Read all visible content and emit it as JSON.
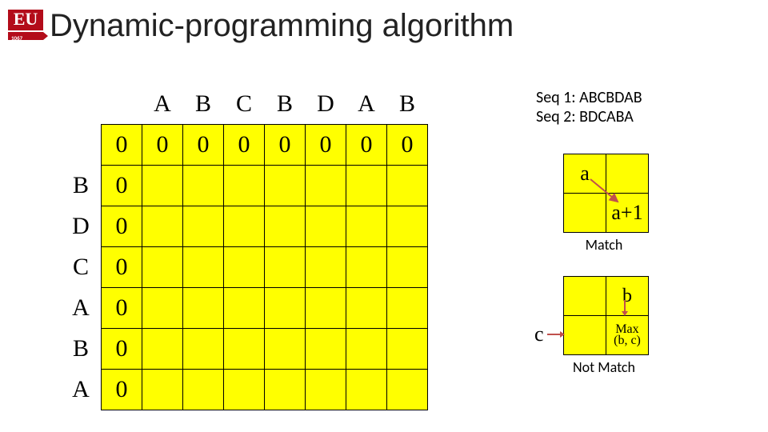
{
  "logo": {
    "text": "EU",
    "year": "1067"
  },
  "title": "Dynamic-programming algorithm",
  "dp": {
    "col_headers": [
      "",
      "A",
      "B",
      "C",
      "B",
      "D",
      "A",
      "B"
    ],
    "row_headers": [
      "",
      "B",
      "D",
      "C",
      "A",
      "B",
      "A"
    ],
    "cells": [
      [
        "0",
        "0",
        "0",
        "0",
        "0",
        "0",
        "0",
        "0"
      ],
      [
        "0",
        "",
        "",
        "",
        "",
        "",
        "",
        ""
      ],
      [
        "0",
        "",
        "",
        "",
        "",
        "",
        "",
        ""
      ],
      [
        "0",
        "",
        "",
        "",
        "",
        "",
        "",
        ""
      ],
      [
        "0",
        "",
        "",
        "",
        "",
        "",
        "",
        ""
      ],
      [
        "0",
        "",
        "",
        "",
        "",
        "",
        "",
        ""
      ],
      [
        "0",
        "",
        "",
        "",
        "",
        "",
        "",
        ""
      ]
    ]
  },
  "seq1_label": "Seq 1: ABCBDAB",
  "seq2_label": "Seq 2: BDCABA",
  "match_box": {
    "tl": "a",
    "br": "a+1",
    "caption": "Match"
  },
  "notmatch_box": {
    "tr": "b",
    "left_label": "c",
    "br_line1": "Max",
    "br_line2": "(b, c)",
    "caption": "Not Match"
  }
}
